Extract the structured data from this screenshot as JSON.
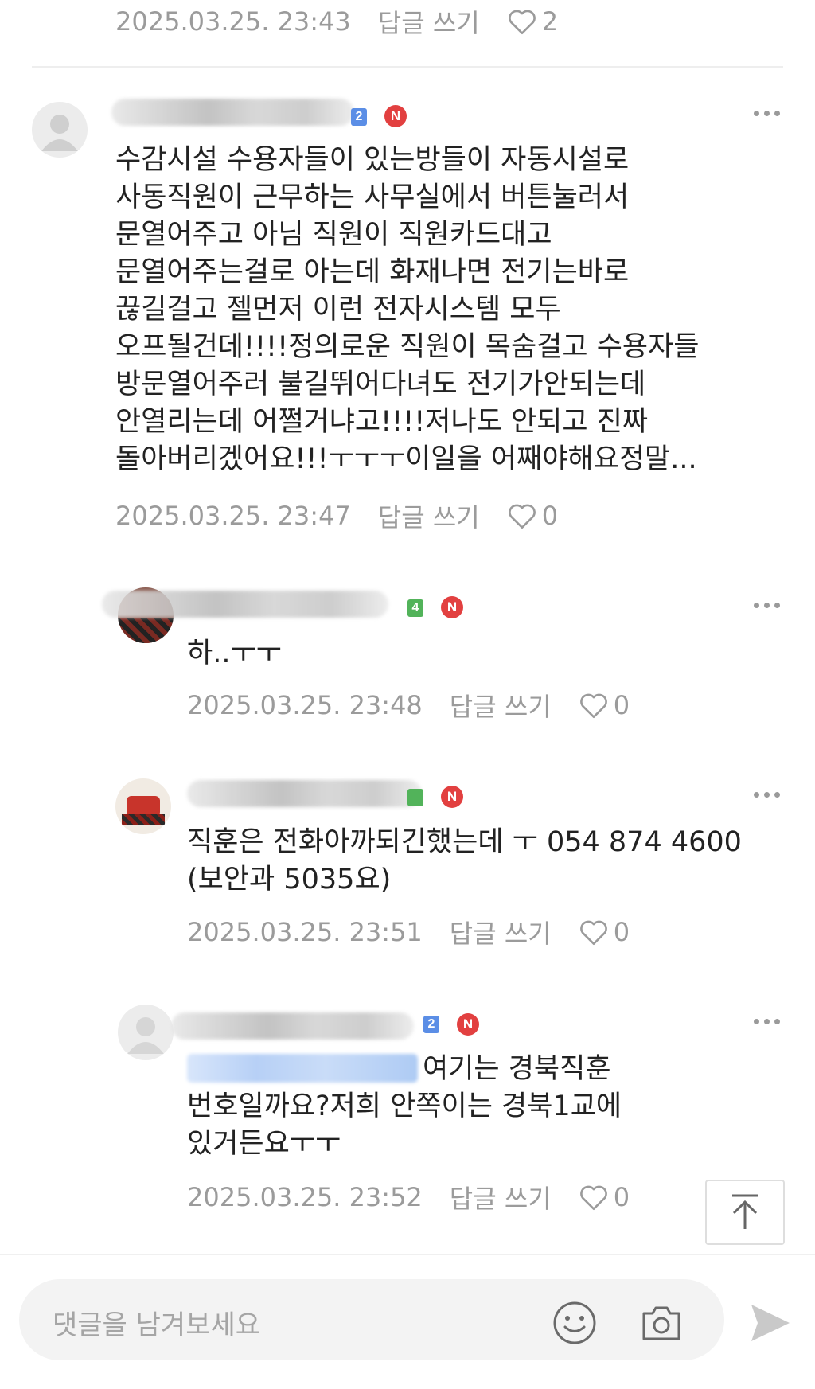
{
  "labels": {
    "reply": "답글 쓰기"
  },
  "comments": [
    {
      "date": "2025.03.25. 23:43",
      "likes": "2"
    },
    {
      "level_badge": "2",
      "badge": "N",
      "body": [
        "수감시설 수용자들이 있는방들이 자동시설로",
        "사동직원이 근무하는 사무실에서 버튼눌러서",
        "문열어주고 아님 직원이 직원카드대고",
        "문열어주는걸로 아는데 화재나면 전기는바로",
        "끊길걸고 젤먼저 이런 전자시스템 모두",
        "오프될건데!!!!정의로운 직원이 목숨걸고 수용자들",
        "방문열어주러 불길뛰어다녀도 전기가안되는데",
        "안열리는데 어쩔거냐고!!!!저나도 안되고 진짜",
        "돌아버리겠어요!!!ㅜㅜㅜ이일을 어째야해요정말..."
      ],
      "date": "2025.03.25. 23:47",
      "likes": "0"
    },
    {
      "level_badge": "4",
      "badge": "N",
      "body": [
        "하..ㅜㅜ"
      ],
      "date": "2025.03.25. 23:48",
      "likes": "0"
    },
    {
      "badge": "N",
      "body": [
        "직훈은 전화아까되긴했는데 ㅜ 054 874 4600",
        "(보안과 5035요)"
      ],
      "date": "2025.03.25. 23:51",
      "likes": "0"
    },
    {
      "level_badge": "2",
      "badge": "N",
      "body_first_after_mention": "여기는 경북직훈",
      "body_rest": [
        "번호일까요?저희 안쪽이는 경북1교에",
        "있거든요ㅜㅜ"
      ],
      "date": "2025.03.25. 23:52",
      "likes": "0"
    }
  ],
  "input": {
    "placeholder": "댓글을 남겨보세요"
  },
  "icons": {
    "more": "more-dots-icon",
    "like": "heart-icon",
    "scroll_top": "arrow-up-icon",
    "emoji": "smiley-icon",
    "camera": "camera-icon",
    "send": "send-icon"
  },
  "colors": {
    "accent": "#3f7fe6",
    "new_badge": "#e24040",
    "meta_text": "#9b9b9b"
  }
}
